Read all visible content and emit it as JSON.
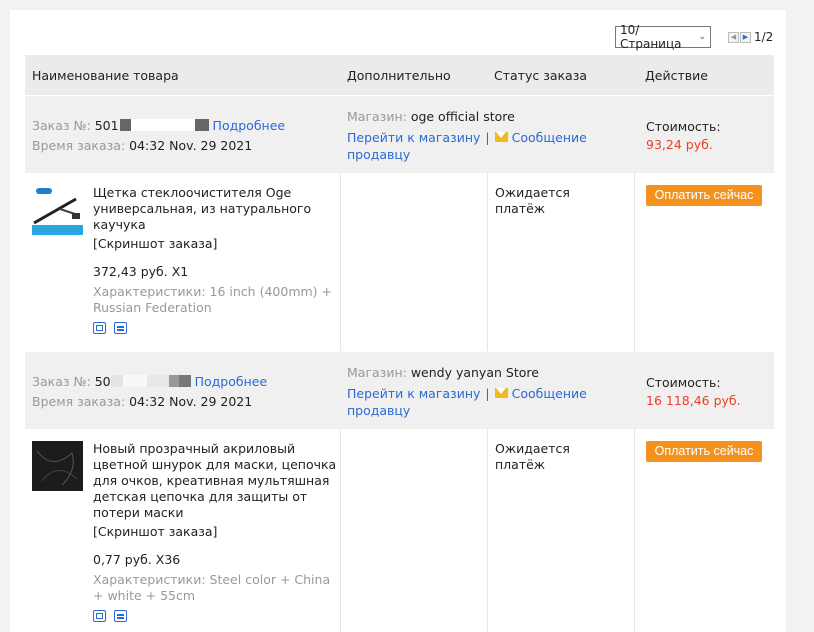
{
  "pagination": {
    "per_page_label": "10/Страница",
    "page_indicator": "1/2"
  },
  "table_headers": {
    "product": "Наименование товара",
    "additional": "Дополнительно",
    "status": "Статус заказа",
    "action": "Действие"
  },
  "orders": [
    {
      "order_label": "Заказ №:",
      "order_number_prefix": "501",
      "details_link": "Подробнее",
      "time_label": "Время заказа:",
      "time_value": "04:32 Nov. 29 2021",
      "store_label": "Магазин:",
      "store_name": "oge official store",
      "goto_store": "Перейти к магазину",
      "message_seller": "Сообщение продавцу",
      "cost_label": "Стоимость:",
      "cost_value": "93,24 руб.",
      "item": {
        "title": "Щетка стеклоочистителя Oge универсальная, из натурального каучука",
        "screenshot": "[Скриншот заказа]",
        "price_qty": "372,43 руб. X1",
        "attributes": "Характеристики: 16 inch (400mm) + Russian Federation",
        "status": "Ожидается платёж",
        "pay_button": "Оплатить сейчас"
      }
    },
    {
      "order_label": "Заказ №:",
      "order_number_prefix": "50",
      "details_link": "Подробнее",
      "time_label": "Время заказа:",
      "time_value": "04:32 Nov. 29 2021",
      "store_label": "Магазин:",
      "store_name": "wendy yanyan Store",
      "goto_store": "Перейти к магазину",
      "message_seller": "Сообщение продавцу",
      "cost_label": "Стоимость:",
      "cost_value": "16 118,46 руб.",
      "item": {
        "title": "Новый прозрачный акриловый цветной шнурок для маски, цепочка для очков, креативная мультяшная детская цепочка для защиты от потери маски",
        "screenshot": "[Скриншот заказа]",
        "price_qty": "0,77 руб. X36",
        "attributes": "Характеристики: Steel color + China + white + 55cm",
        "status": "Ожидается платёж",
        "pay_button": "Оплатить сейчас"
      }
    }
  ],
  "colors": {
    "link": "#2a6ad6",
    "price": "#e8412b",
    "pay_button": "#f5921e",
    "header_bg": "#ebebeb"
  }
}
